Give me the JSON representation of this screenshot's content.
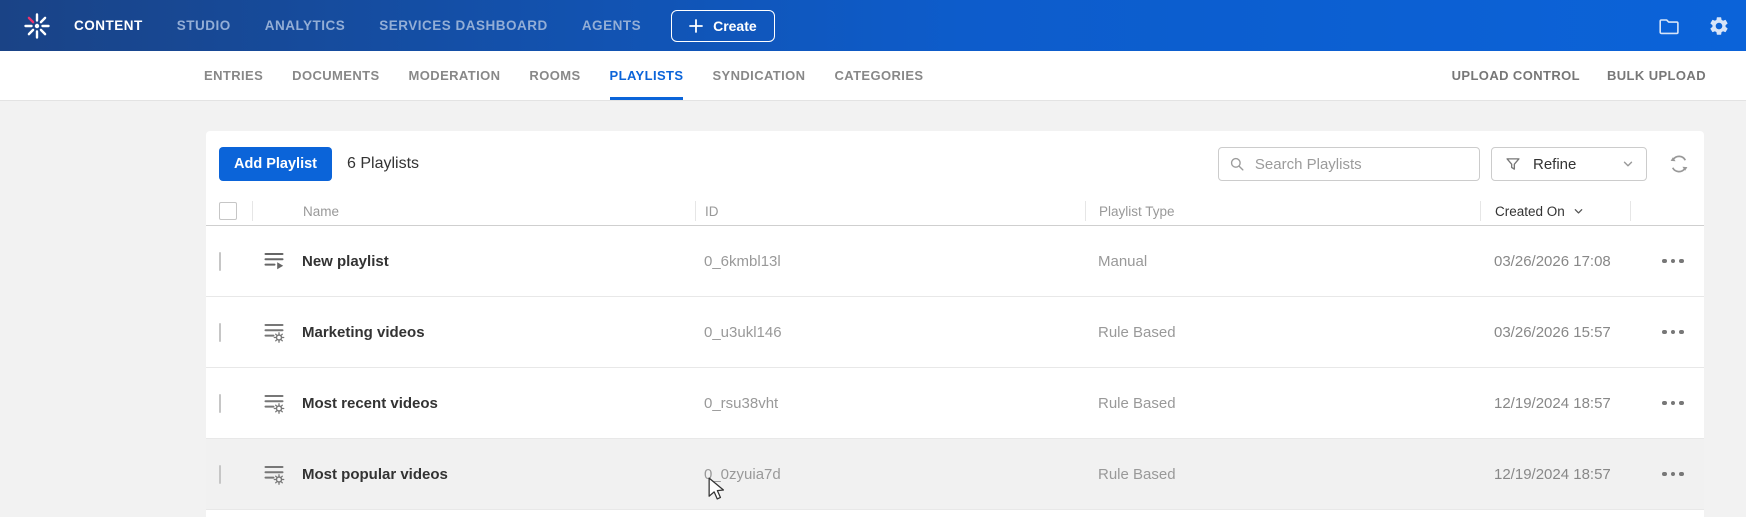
{
  "topbar": {
    "logo": "kaltura-starburst-logo",
    "nav": [
      {
        "label": "CONTENT",
        "active": true
      },
      {
        "label": "STUDIO",
        "active": false
      },
      {
        "label": "ANALYTICS",
        "active": false
      },
      {
        "label": "SERVICES DASHBOARD",
        "active": false
      },
      {
        "label": "AGENTS",
        "active": false
      }
    ],
    "create_label": "Create",
    "icons": [
      "folder-icon",
      "gear-icon"
    ]
  },
  "subnav": {
    "tabs": [
      {
        "label": "ENTRIES",
        "active": false
      },
      {
        "label": "DOCUMENTS",
        "active": false
      },
      {
        "label": "MODERATION",
        "active": false
      },
      {
        "label": "ROOMS",
        "active": false
      },
      {
        "label": "PLAYLISTS",
        "active": true
      },
      {
        "label": "SYNDICATION",
        "active": false
      },
      {
        "label": "CATEGORIES",
        "active": false
      }
    ],
    "right": [
      "UPLOAD CONTROL",
      "BULK UPLOAD"
    ]
  },
  "toolbar": {
    "add_button": "Add Playlist",
    "count": "6 Playlists",
    "search_placeholder": "Search Playlists",
    "search_value": "",
    "refine_label": "Refine"
  },
  "table": {
    "columns": [
      "Name",
      "ID",
      "Playlist Type",
      "Created On"
    ],
    "sorted_by": "Created On",
    "rows": [
      {
        "name": "New playlist",
        "id": "0_6kmbl13l",
        "type": "Manual",
        "created": "03/26/2026 17:08",
        "icon": "playlist-manual-icon",
        "state": "normal"
      },
      {
        "name": "Marketing videos",
        "id": "0_u3ukl146",
        "type": "Rule Based",
        "created": "03/26/2026 15:57",
        "icon": "playlist-rule-icon",
        "state": "normal"
      },
      {
        "name": "Most recent videos",
        "id": "0_rsu38vht",
        "type": "Rule Based",
        "created": "12/19/2024 18:57",
        "icon": "playlist-rule-icon",
        "state": "normal"
      },
      {
        "name": "Most popular videos",
        "id": "0_0zyuia7d",
        "type": "Rule Based",
        "created": "12/19/2024 18:57",
        "icon": "playlist-rule-icon",
        "state": "hover"
      }
    ]
  },
  "colors": {
    "accent": "#0b64d9",
    "topbar_gradient_left": "#1a4386",
    "topbar_gradient_right": "#0b63d9",
    "page_background": "#f2f2f2",
    "hover_row": "#f1f1f1",
    "muted_text": "#999999",
    "dark_text": "#333333"
  }
}
